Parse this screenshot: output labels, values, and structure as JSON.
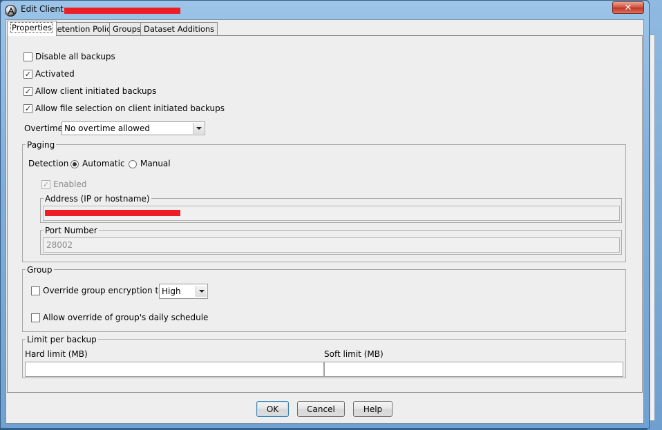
{
  "window": {
    "title": "Edit Client - ",
    "close_glyph": "✕"
  },
  "tabs": [
    {
      "label": "Properties",
      "active": true
    },
    {
      "label": "Retention Policy",
      "active": false
    },
    {
      "label": "Groups",
      "active": false
    },
    {
      "label": "Dataset Additions",
      "active": false
    }
  ],
  "properties": {
    "disable_all_backups": {
      "label": "Disable all backups",
      "checked": false
    },
    "activated": {
      "label": "Activated",
      "checked": true
    },
    "allow_client_backups": {
      "label": "Allow client initiated backups",
      "checked": true
    },
    "allow_file_selection": {
      "label": "Allow file selection on client initiated backups",
      "checked": true
    },
    "overtime": {
      "label": "Overtime",
      "value": "No overtime allowed"
    }
  },
  "paging": {
    "title": "Paging",
    "detection_label": "Detection",
    "automatic_label": "Automatic",
    "manual_label": "Manual",
    "selected": "Automatic",
    "enabled": {
      "label": "Enabled",
      "checked": true,
      "disabled": true
    },
    "address": {
      "title": "Address (IP or hostname)",
      "value": ""
    },
    "port": {
      "title": "Port Number",
      "value": "28002"
    }
  },
  "group": {
    "title": "Group",
    "override_encryption": {
      "label": "Override group encryption to",
      "checked": false
    },
    "encryption_value": "High",
    "override_schedule": {
      "label": "Allow override of group's daily schedule",
      "checked": false
    }
  },
  "limit": {
    "title": "Limit per backup",
    "hard_label": "Hard limit (MB)",
    "hard_value": "",
    "soft_label": "Soft limit (MB)",
    "soft_value": ""
  },
  "buttons": {
    "ok": "OK",
    "cancel": "Cancel",
    "help": "Help"
  },
  "colors": {
    "redaction": "#ee1c25",
    "frame": "#7fb0dc"
  },
  "icons": {
    "app": "app-logo-icon",
    "close": "close-icon",
    "check": "checkmark-icon",
    "dropdown": "chevron-down-icon"
  }
}
